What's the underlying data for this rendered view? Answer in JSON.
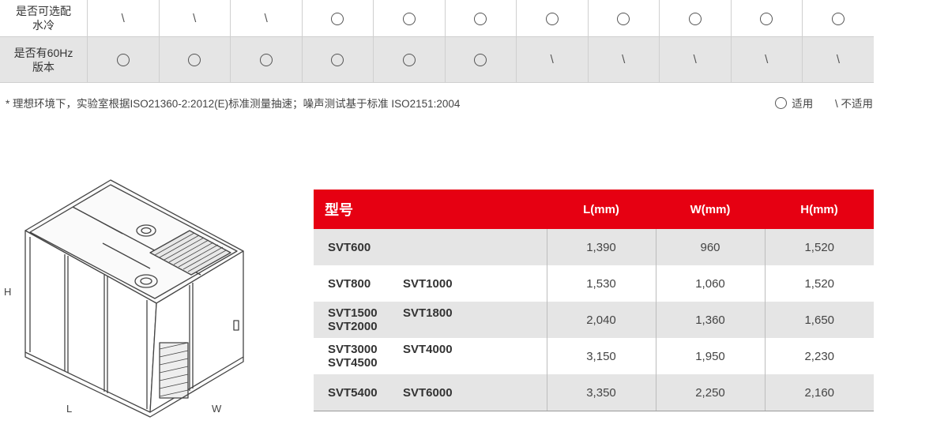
{
  "spec_table": {
    "rows": [
      {
        "label_line1": "是否可选配",
        "label_line2": "水冷",
        "cells": [
          "\\",
          "\\",
          "\\",
          "○",
          "○",
          "○",
          "○",
          "○",
          "○",
          "○",
          "○"
        ]
      },
      {
        "label_line1": "是否有60Hz",
        "label_line2": "版本",
        "cells": [
          "○",
          "○",
          "○",
          "○",
          "○",
          "○",
          "\\",
          "\\",
          "\\",
          "\\",
          "\\"
        ]
      }
    ]
  },
  "footnote": "* 理想环境下，实验室根据ISO21360-2:2012(E)标准测量抽速；噪声测试基于标准 ISO2151:2004",
  "legend": {
    "applicable": "适用",
    "not_applicable": "\\ 不适用"
  },
  "drawing": {
    "label_h": "H",
    "label_l": "L",
    "label_w": "W"
  },
  "dimensions": {
    "header": {
      "model": "型号",
      "l": "L(mm)",
      "w": "W(mm)",
      "h": "H(mm)"
    },
    "rows": [
      {
        "models": [
          "SVT600"
        ],
        "l": "1,390",
        "w": "960",
        "h": "1,520"
      },
      {
        "models": [
          "SVT800",
          "SVT1000"
        ],
        "l": "1,530",
        "w": "1,060",
        "h": "1,520"
      },
      {
        "models": [
          "SVT1500",
          "SVT1800",
          "SVT2000"
        ],
        "l": "2,040",
        "w": "1,360",
        "h": "1,650"
      },
      {
        "models": [
          "SVT3000",
          "SVT4000",
          "SVT4500"
        ],
        "l": "3,150",
        "w": "1,950",
        "h": "2,230"
      },
      {
        "models": [
          "SVT5400",
          "SVT6000"
        ],
        "l": "3,350",
        "w": "2,250",
        "h": "2,160"
      }
    ]
  }
}
